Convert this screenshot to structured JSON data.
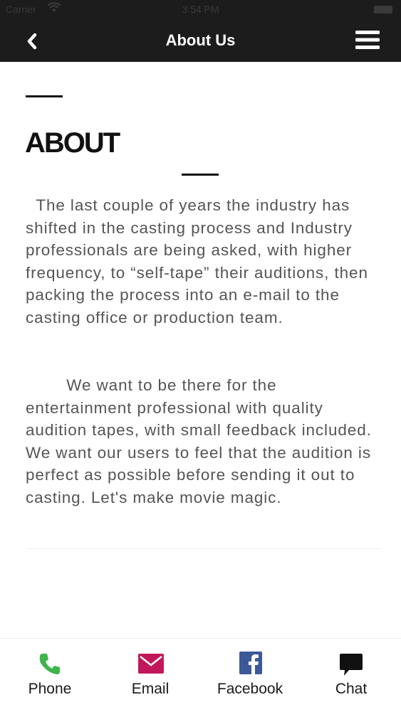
{
  "status_bar": {
    "carrier": "Carrier",
    "time": "3:54 PM"
  },
  "nav": {
    "title": "About Us",
    "back_icon": "chevron-left-icon",
    "menu_icon": "hamburger-menu-icon"
  },
  "content": {
    "heading": "ABOUT",
    "paragraph_1": "  The last couple of years the industry has shifted in the casting process and Industry professionals are being asked, with higher frequency, to “self-tape” their auditions, then packing the process into an e-mail to the casting office or production team.",
    "paragraph_2": "        We want to be there for the entertainment professional with quality audition tapes, with small feedback included. We want our users to feel that the audition is perfect as possible before sending it out to casting. Let's make movie magic."
  },
  "tabs": [
    {
      "label": "Phone",
      "icon": "phone-icon",
      "color": "#3cb54a"
    },
    {
      "label": "Email",
      "icon": "email-icon",
      "color": "#c2185b"
    },
    {
      "label": "Facebook",
      "icon": "facebook-icon",
      "color": "#3b5998"
    },
    {
      "label": "Chat",
      "icon": "chat-icon",
      "color": "#111111"
    }
  ]
}
